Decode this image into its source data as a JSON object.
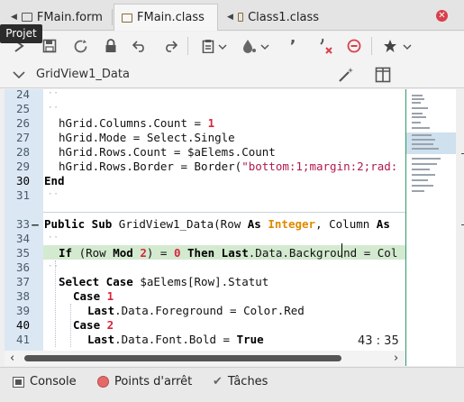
{
  "tabs": [
    {
      "label": "FMain.form"
    },
    {
      "label": "FMain.class"
    },
    {
      "label": "Class1.class"
    }
  ],
  "tooltip": "Projet",
  "method_selector": "GridView1_Data",
  "cursor_position": "43 : 35",
  "editor": {
    "line_numbers": [
      "24",
      "25",
      "26",
      "27",
      "28",
      "29",
      "30",
      "31",
      "",
      "33",
      "34",
      "35",
      "36",
      "37",
      "38",
      "39",
      "40",
      "41"
    ],
    "lines": {
      "l26_a": "hGrid.Columns.Count = ",
      "l26_b": "1",
      "l27": "hGrid.Mode = Select.Single",
      "l28": "hGrid.Rows.Count = $aElems.Count",
      "l29_a": "hGrid.Rows.Border = Border(",
      "l29_b": "\"bottom:1;margin:2;rad:",
      "l30": "End",
      "l33_kw": "Public Sub",
      "l33_a": " GridView1_Data(Row ",
      "l33_as1": "As",
      "l33_typ": "Integer",
      "l33_b": ", Column ",
      "l33_as2": "As",
      "l35_if": "If",
      "l35_a": " (Row ",
      "l35_mod": "Mod",
      "l35_n2": "2",
      "l35_b": ") = ",
      "l35_n0": "0",
      "l35_then": "Then",
      "l35_last": "Last",
      "l35_c": ".Data.Background = Col",
      "l37_sel": "Select Case",
      "l37_a": " $aElems[Row].Statut",
      "l38_case": "Case",
      "l38_n": "1",
      "l39_last": "Last",
      "l39_a": ".Data.Foreground = Color.Red",
      "l40_case": "Case",
      "l40_n": "2",
      "l41_last": "Last",
      "l41_a": ".Data.Font.Bold = ",
      "l41_true": "True"
    }
  },
  "bottom": {
    "console": "Console",
    "breakpoints": "Points d'arrêt",
    "tasks": "Tâches"
  },
  "colors": {
    "gutter": "#dbe8f4",
    "highlight_line": "#d4ead0",
    "number": "#d7263d",
    "type": "#e08a00",
    "string": "#b2184a",
    "close": "#d9404b"
  }
}
